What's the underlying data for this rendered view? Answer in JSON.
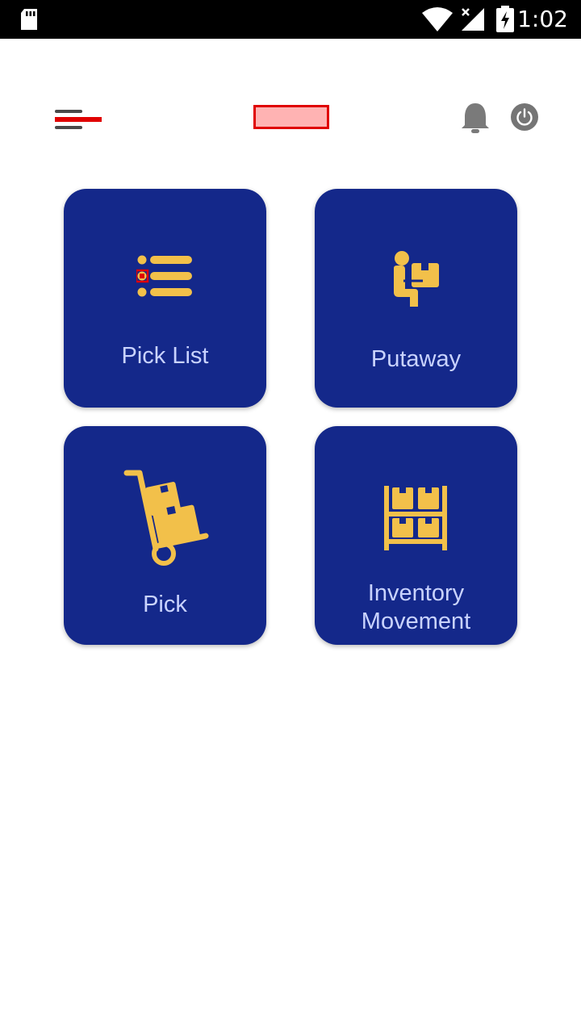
{
  "status_bar": {
    "time": "1:02",
    "icons": [
      "sd-card-icon",
      "wifi-icon",
      "no-signal-icon",
      "battery-charging-icon"
    ]
  },
  "header": {
    "menu_icon": "hamburger-menu-icon",
    "notification_icon": "bell-icon",
    "power_icon": "power-icon"
  },
  "tiles": [
    {
      "label": "Pick List",
      "icon": "list-icon"
    },
    {
      "label": "Putaway",
      "icon": "worker-box-icon"
    },
    {
      "label": "Pick",
      "icon": "hand-truck-icon"
    },
    {
      "label": "Inventory Movement",
      "icon": "shelf-boxes-icon"
    }
  ],
  "colors": {
    "tile_background": "#14288a",
    "tile_label": "#c9d3ff",
    "icon_accent": "#f2c04a",
    "highlight_red": "#e00000"
  }
}
